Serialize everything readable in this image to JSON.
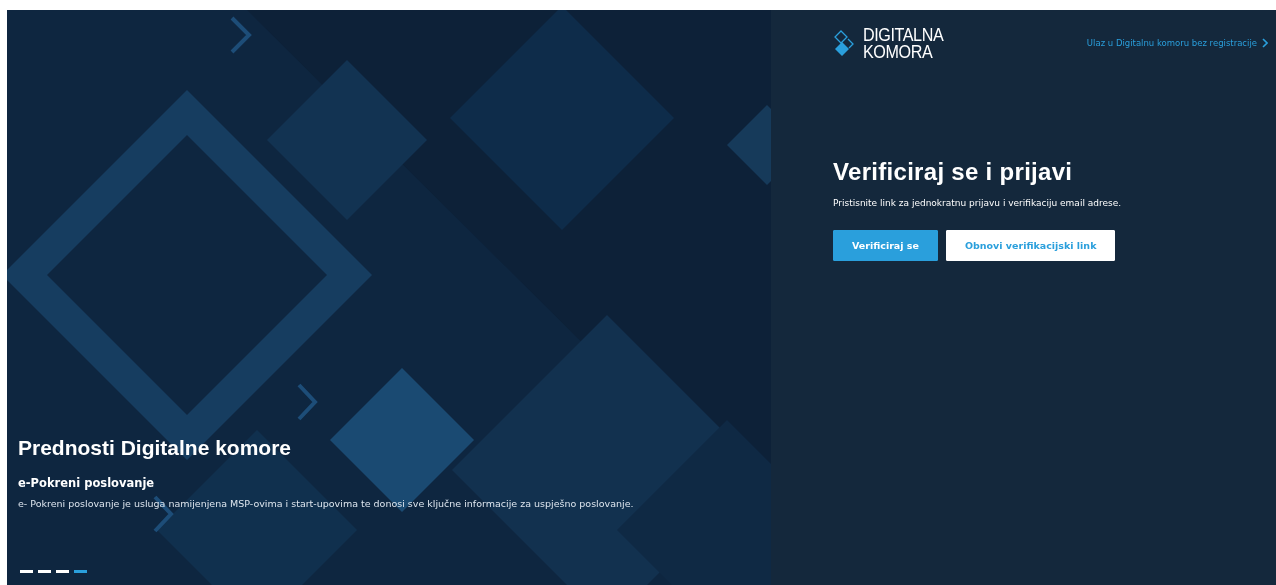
{
  "slider": {
    "title": "Prednosti Digitalne komore",
    "subtitle": "e-Pokreni poslovanje",
    "text": "e- Pokreni poslovanje je usluga namijenjena MSP-ovima i start-upovima te donosi sve ključne informacije za uspješno poslovanje.",
    "dots": [
      {
        "selected": false
      },
      {
        "selected": false
      },
      {
        "selected": false
      },
      {
        "selected": true
      }
    ]
  },
  "logo": {
    "line_1": "DIGITALNA",
    "line_2": "KOMORA"
  },
  "guest_link": "Ulaz u Digitalnu komoru bez registracije",
  "login": {
    "title": "Verificiraj se i prijavi",
    "text": "Pristisnite link za jednokratnu prijavu i verifikaciju email adrese.",
    "buttons": [
      {
        "label": "Verificiraj se",
        "kind": "primary"
      },
      {
        "label": "Obnovi verifikacijski link",
        "kind": "secondary"
      }
    ]
  }
}
